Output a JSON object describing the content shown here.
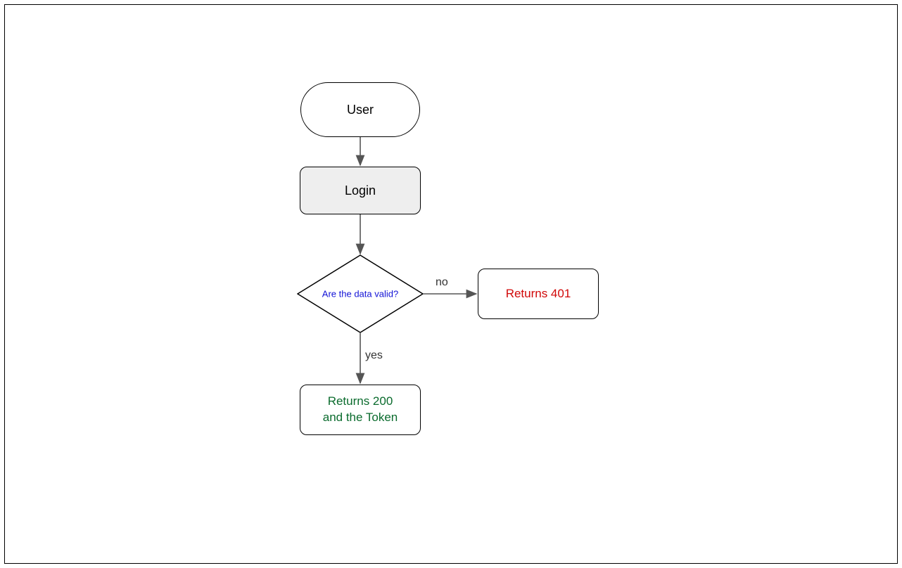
{
  "nodes": {
    "user": "User",
    "login": "Login",
    "decision": "Are the data valid?",
    "result401": "Returns 401",
    "result200_line1": "Returns 200",
    "result200_line2": "and the Token"
  },
  "edges": {
    "no": "no",
    "yes": "yes"
  },
  "colors": {
    "decisionText": "#1212d6",
    "errorText": "#d10808",
    "successText": "#0a6b2d",
    "arrow": "#555555"
  }
}
